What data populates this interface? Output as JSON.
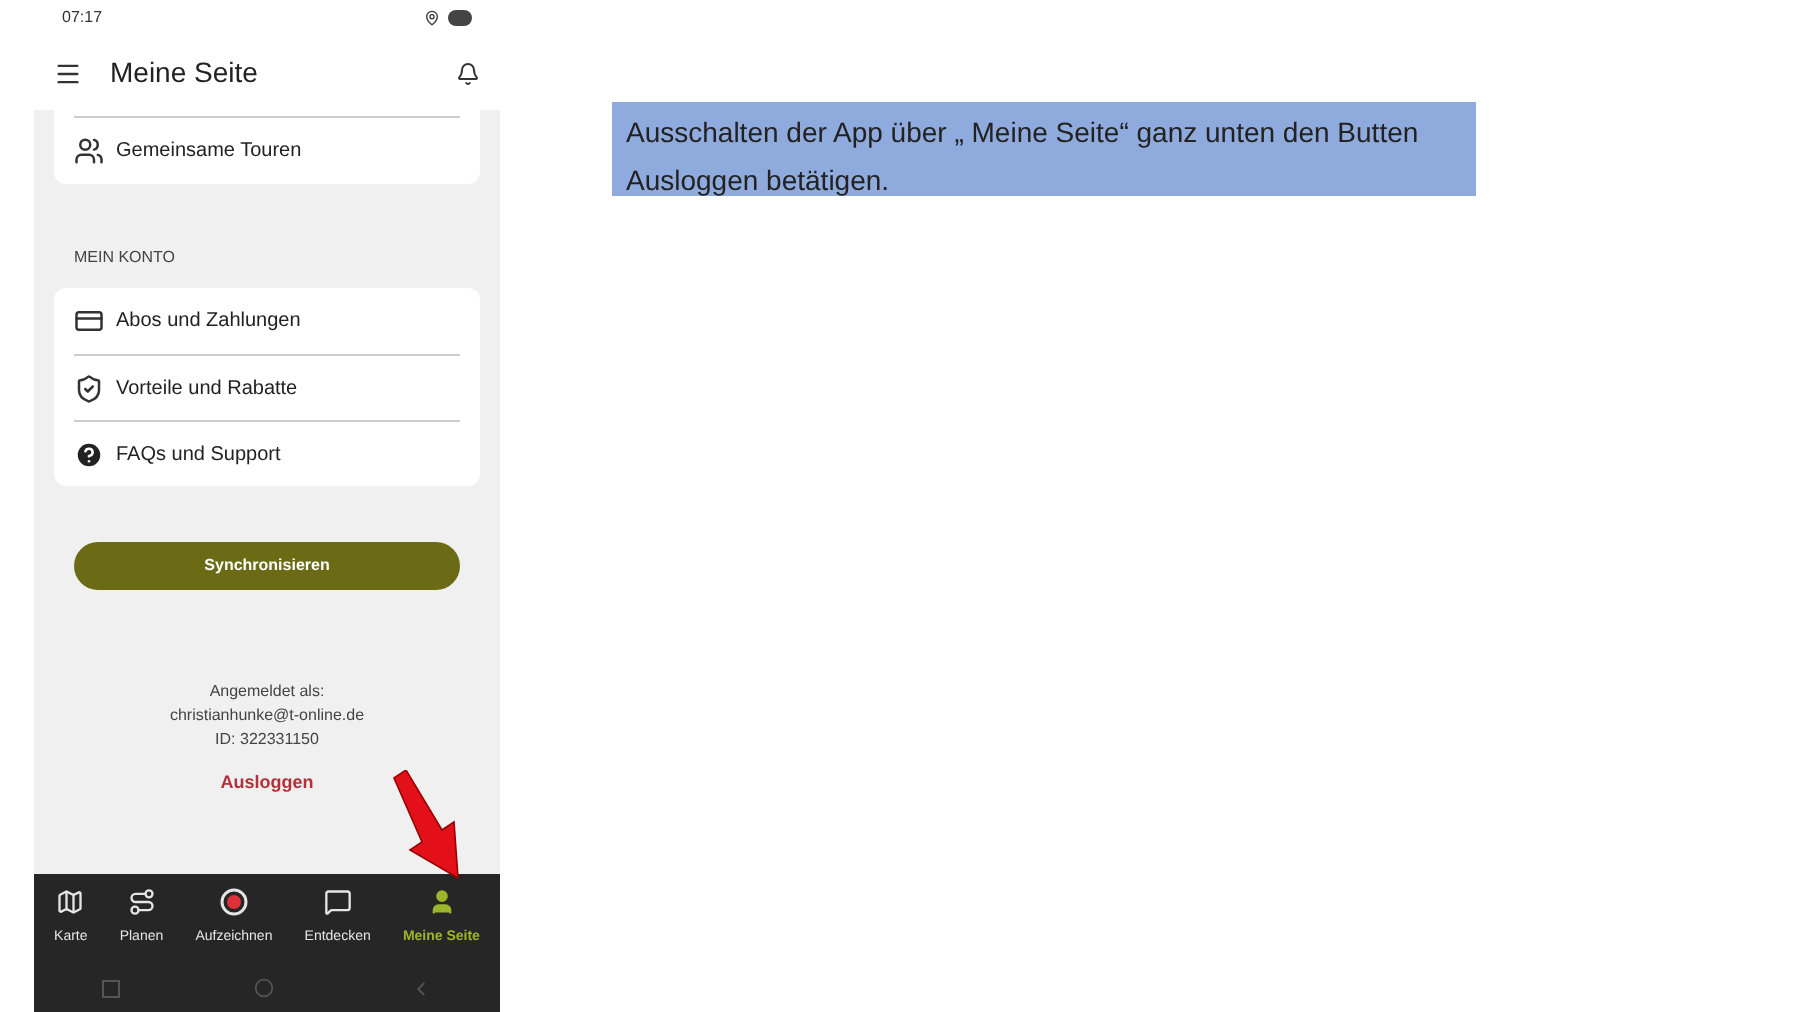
{
  "status_bar": {
    "time": "07:17"
  },
  "header": {
    "title": "Meine Seite"
  },
  "tours_card": {
    "items": [
      {
        "label": "Gemeinsame Touren",
        "kind": "tours"
      }
    ]
  },
  "account": {
    "heading": "MEIN KONTO",
    "items": [
      {
        "label": "Abos und Zahlungen",
        "kind": "card"
      },
      {
        "label": "Vorteile und Rabatte",
        "kind": "shield"
      },
      {
        "label": "FAQs und Support",
        "kind": "help"
      }
    ]
  },
  "sync_button": "Synchronisieren",
  "login": {
    "label": "Angemeldet als:",
    "email": "christianhunke@t-online.de",
    "id": "ID: 322331150"
  },
  "logout_link": "Ausloggen",
  "bottom_nav": [
    {
      "label": "Karte",
      "kind": "map",
      "selected": false
    },
    {
      "label": "Planen",
      "kind": "plan",
      "selected": false
    },
    {
      "label": "Aufzeichnen",
      "kind": "record",
      "selected": false
    },
    {
      "label": "Entdecken",
      "kind": "discover",
      "selected": false
    },
    {
      "label": "Meine Seite",
      "kind": "profile",
      "selected": true
    }
  ],
  "callout": "Ausschalten der App über „ Meine Seite“ ganz unten den Butten Ausloggen betätigen."
}
